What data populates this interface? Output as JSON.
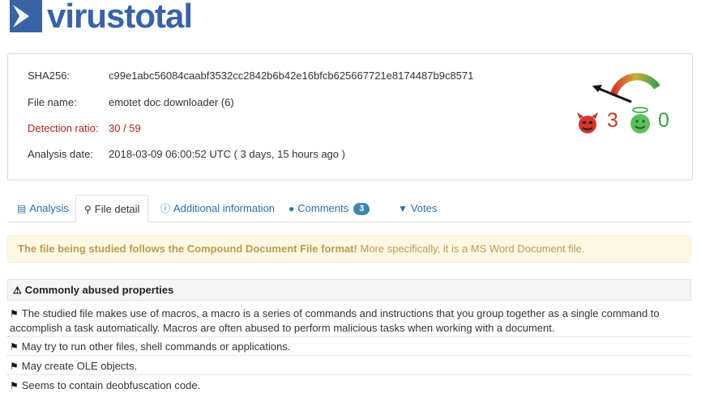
{
  "brand": {
    "virus": "virus",
    "total": "total"
  },
  "summary": {
    "sha256_label": "SHA256:",
    "sha256_value": "c99e1abc56084caabf3532cc2842b6b42e16bfcb625667721e8174487b9c8571",
    "filename_label": "File name:",
    "filename_value": "emotet doc downloader (6)",
    "ratio_label": "Detection ratio:",
    "ratio_value": "30 / 59",
    "date_label": "Analysis date:",
    "date_value": "2018-03-09 06:00:52 UTC ( 3 days, 15 hours ago )"
  },
  "votes": {
    "bad": "3",
    "good": "0"
  },
  "tabs": [
    {
      "label": "Analysis",
      "icon": "table-icon"
    },
    {
      "label": "File detail",
      "icon": "search-icon"
    },
    {
      "label": "Additional information",
      "icon": "info-icon"
    },
    {
      "label": "Comments",
      "icon": "comment-icon",
      "badge": "3"
    },
    {
      "label": "Votes",
      "icon": "thumbs-down-icon"
    }
  ],
  "notice": {
    "bold": "The file being studied follows the Compound Document File format!",
    "rest": " More specifically, it is a MS Word Document file."
  },
  "section": {
    "title": "Commonly abused properties"
  },
  "properties": [
    "The studied file makes use of macros, a macro is a series of commands and instructions that you group together as a single command to accomplish a task automatically. Macros are often abused to perform malicious tasks when working with a document.",
    "May try to run other files, shell commands or applications.",
    "May create OLE objects.",
    "Seems to contain deobfuscation code."
  ],
  "colors": {
    "accent": "#3a63a6",
    "link": "#2a6fb0",
    "danger": "#c0392b",
    "ok": "#3aa04a",
    "warning_bg": "#fcf8e3",
    "warning_text": "#c09853"
  }
}
